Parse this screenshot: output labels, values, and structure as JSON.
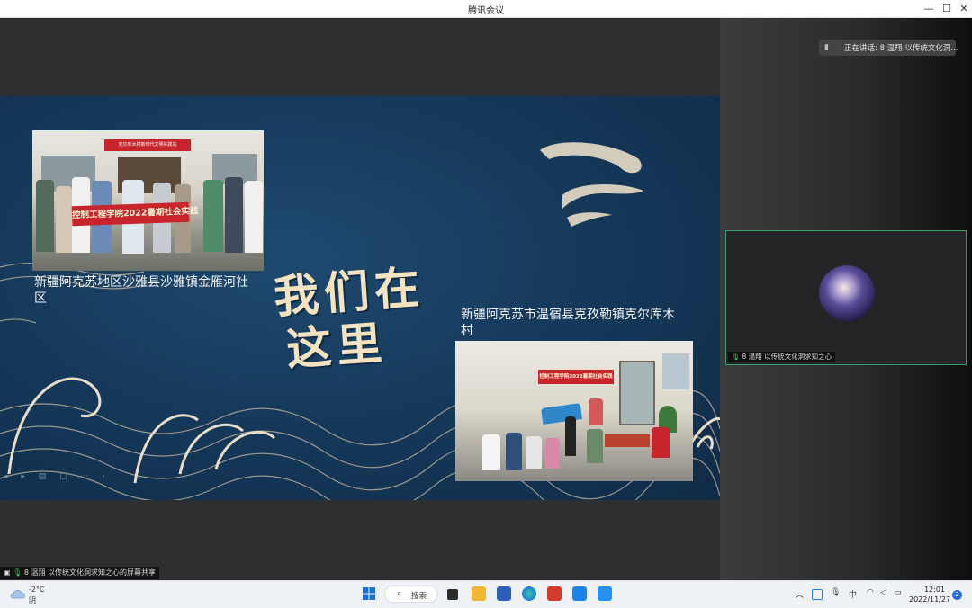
{
  "window": {
    "title": "腾讯会议"
  },
  "window_controls": {
    "minimize": "—",
    "maximize": "☐",
    "close": "✕"
  },
  "speaker_indicator": {
    "text": "正在讲话: 8 温翔 以传统文化洞..."
  },
  "video_tile": {
    "name": "8 温翔 以传统文化洞求知之心"
  },
  "slide": {
    "title_line1": "我们在",
    "title_line2": "这里",
    "caption1": "新疆阿克苏地区沙雅县沙雅镇金雁河社区",
    "caption2": "新疆阿克苏市温宿县克孜勒镇克尔库木村",
    "photo1": {
      "banner": "控制工程学院2022暑期社会实践",
      "sign": "克尔库木村新时代文明实践站"
    },
    "photo2": {
      "banner": "控制工程学院2022暑期社会实践"
    }
  },
  "share_bar": {
    "text": "8 温翔 以传统文化洞求知之心的屏幕共享"
  },
  "taskbar": {
    "weather_temp": "-2°C",
    "weather_desc": "阴",
    "search_label": "搜索",
    "ime": "中",
    "time": "12:01",
    "date": "2022/11/27",
    "notification_count": "2"
  },
  "colors": {
    "accent_green": "#38d16a",
    "slide_bg": "#163a5c",
    "banner_red": "#c8242b",
    "title_cream": "#f3e3c0"
  }
}
